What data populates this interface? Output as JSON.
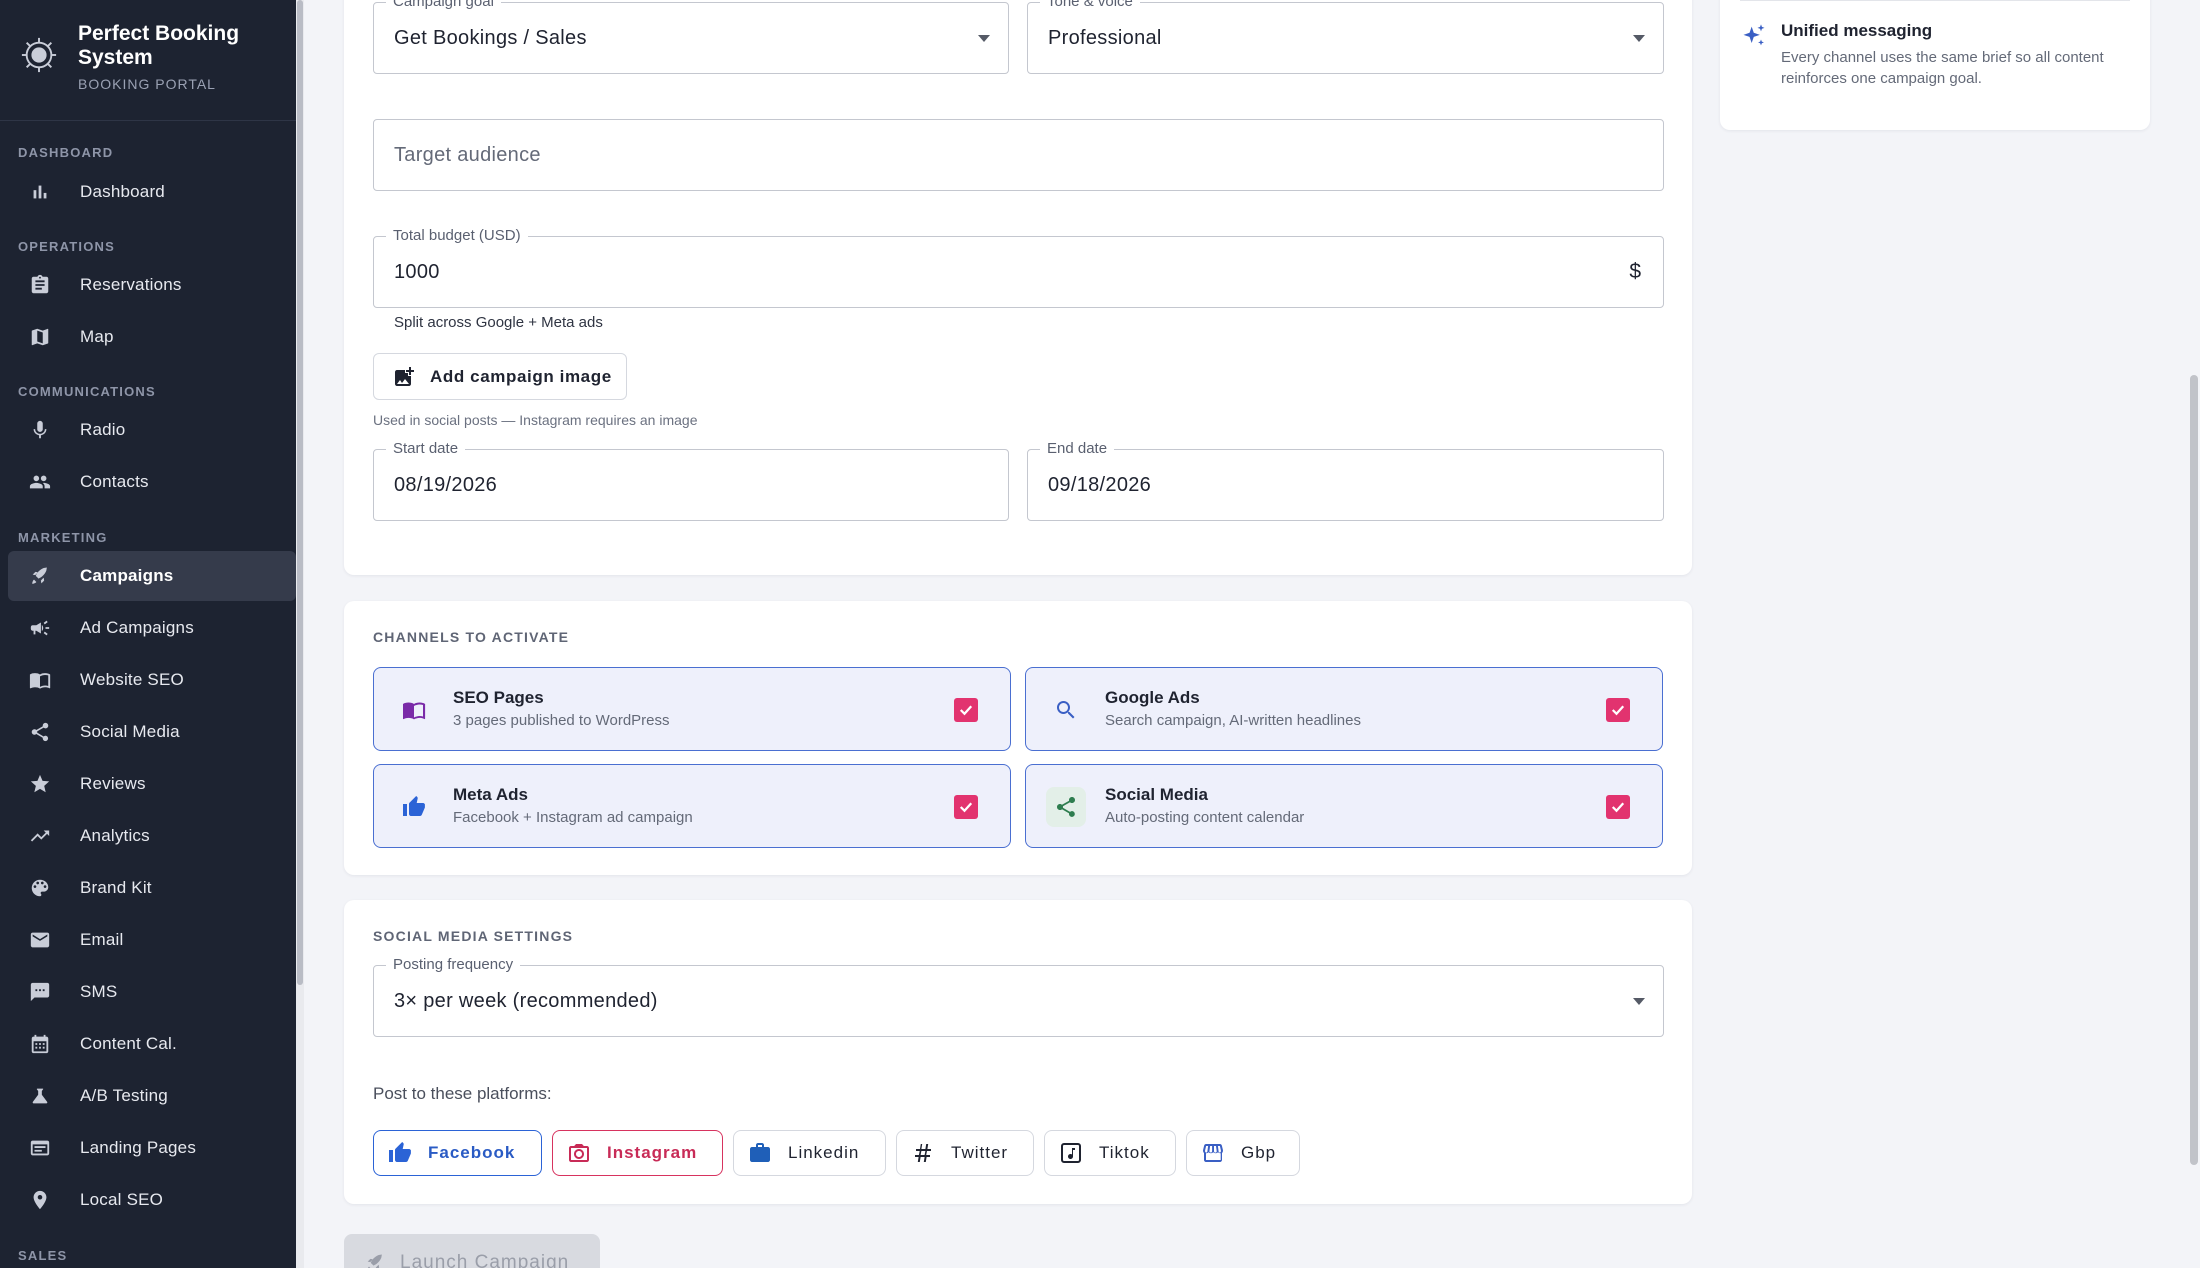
{
  "sidebar": {
    "brand_name": "Perfect Booking System",
    "brand_sub": "BOOKING PORTAL",
    "sections": {
      "dashboard": "DASHBOARD",
      "operations": "OPERATIONS",
      "communications": "COMMUNICATIONS",
      "marketing": "MARKETING",
      "sales": "SALES"
    },
    "items": {
      "dashboard": "Dashboard",
      "reservations": "Reservations",
      "map": "Map",
      "radio": "Radio",
      "contacts": "Contacts",
      "campaigns": "Campaigns",
      "ad_campaigns": "Ad Campaigns",
      "website_seo": "Website SEO",
      "social_media": "Social Media",
      "reviews": "Reviews",
      "analytics": "Analytics",
      "brand_kit": "Brand Kit",
      "email": "Email",
      "sms": "SMS",
      "content_cal": "Content Cal.",
      "ab_testing": "A/B Testing",
      "landing_pages": "Landing Pages",
      "local_seo": "Local SEO"
    },
    "active_item": "Campaigns"
  },
  "form": {
    "campaign_goal": {
      "label": "Campaign goal",
      "value": "Get Bookings / Sales"
    },
    "tone_voice": {
      "label": "Tone & voice",
      "value": "Professional"
    },
    "target_audience": {
      "placeholder": "Target audience"
    },
    "budget": {
      "label": "Total budget (USD)",
      "value": "1000",
      "adornment": "$",
      "helper": "Split across Google + Meta ads"
    },
    "add_image": {
      "label": "Add campaign image",
      "helper": "Used in social posts — Instagram requires an image"
    },
    "start_date": {
      "label": "Start date",
      "value": "08/19/2026"
    },
    "end_date": {
      "label": "End date",
      "value": "09/18/2026"
    }
  },
  "channels": {
    "title": "CHANNELS TO ACTIVATE",
    "seo": {
      "title": "SEO Pages",
      "desc": "3 pages published to WordPress",
      "checked": true
    },
    "google": {
      "title": "Google Ads",
      "desc": "Search campaign, AI-written headlines",
      "checked": true
    },
    "meta": {
      "title": "Meta Ads",
      "desc": "Facebook + Instagram ad campaign",
      "checked": true
    },
    "social": {
      "title": "Social Media",
      "desc": "Auto-posting content calendar",
      "checked": true
    }
  },
  "social_settings": {
    "title": "SOCIAL MEDIA SETTINGS",
    "frequency": {
      "label": "Posting frequency",
      "value": "3× per week (recommended)"
    },
    "platforms_label": "Post to these platforms:",
    "platforms": {
      "facebook": {
        "label": "Facebook",
        "selected": true
      },
      "instagram": {
        "label": "Instagram",
        "selected": true
      },
      "linkedin": {
        "label": "Linkedin",
        "selected": false
      },
      "twitter": {
        "label": "Twitter",
        "selected": false
      },
      "tiktok": {
        "label": "Tiktok",
        "selected": false
      },
      "gbp": {
        "label": "Gbp",
        "selected": false
      }
    }
  },
  "launch_button": "Launch Campaign",
  "tip": {
    "title": "Unified messaging",
    "body": "Every channel uses the same brief so all content reinforces one campaign goal."
  },
  "colors": {
    "sidebar_bg": "#1d2331",
    "accent_blue": "#4a6fd1",
    "checkbox_pink": "#e2336f",
    "facebook_blue": "#2b63d6",
    "instagram_red": "#d7335f"
  }
}
